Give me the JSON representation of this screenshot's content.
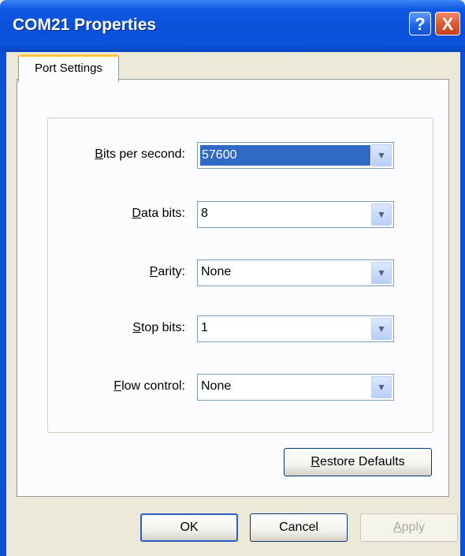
{
  "window": {
    "title": "COM21 Properties"
  },
  "titlebar": {
    "help_label": "?",
    "close_label": "X"
  },
  "tabs": [
    {
      "label": "Port Settings"
    }
  ],
  "fields": [
    {
      "mnemonic": "B",
      "rest": "its per second:",
      "value": "57600"
    },
    {
      "mnemonic": "D",
      "rest": "ata bits:",
      "value": "8"
    },
    {
      "mnemonic": "P",
      "rest": "arity:",
      "value": "None"
    },
    {
      "mnemonic": "S",
      "rest": "top bits:",
      "value": "1"
    },
    {
      "mnemonic": "F",
      "rest": "low control:",
      "value": "None"
    }
  ],
  "buttons": {
    "restore": {
      "mnemonic": "R",
      "rest": "estore Defaults"
    },
    "ok": "OK",
    "cancel": "Cancel",
    "apply": {
      "mnemonic": "A",
      "rest": "pply"
    }
  }
}
